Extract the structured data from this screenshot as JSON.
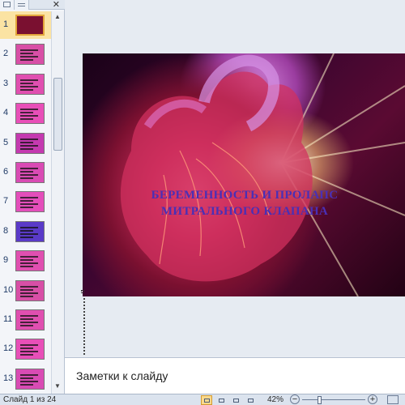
{
  "left_pane": {
    "close_glyph": "✕",
    "thumbnails": [
      {
        "num": "1",
        "bg": "#7a1030",
        "selected": true
      },
      {
        "num": "2",
        "bg": "#d84fa6",
        "selected": false
      },
      {
        "num": "3",
        "bg": "#e04fb0",
        "selected": false
      },
      {
        "num": "4",
        "bg": "#e84fb8",
        "selected": false
      },
      {
        "num": "5",
        "bg": "#c43ab0",
        "selected": false
      },
      {
        "num": "6",
        "bg": "#d94bb4",
        "selected": false
      },
      {
        "num": "7",
        "bg": "#e44ebb",
        "selected": false
      },
      {
        "num": "8",
        "bg": "#5a3ac8",
        "selected": false
      },
      {
        "num": "9",
        "bg": "#e04fb0",
        "selected": false
      },
      {
        "num": "10",
        "bg": "#d84fa6",
        "selected": false
      },
      {
        "num": "11",
        "bg": "#e04fb0",
        "selected": false
      },
      {
        "num": "12",
        "bg": "#e84fb8",
        "selected": false
      },
      {
        "num": "13",
        "bg": "#d94bb4",
        "selected": false
      }
    ],
    "scroll_up": "▲",
    "scroll_down": "▼"
  },
  "slide": {
    "title_line1": "БЕРЕМЕННОСТЬ  И ПРОЛАПС",
    "title_line2": "МИТРАЛЬНОГО КЛАПАНА"
  },
  "notes": {
    "placeholder": "Заметки к слайду"
  },
  "status_bar": {
    "slide_counter": "Слайд 1 из 24",
    "zoom_level": "42%",
    "zoom_fraction": 0.28,
    "zoom_out": "−",
    "zoom_in": "+"
  }
}
